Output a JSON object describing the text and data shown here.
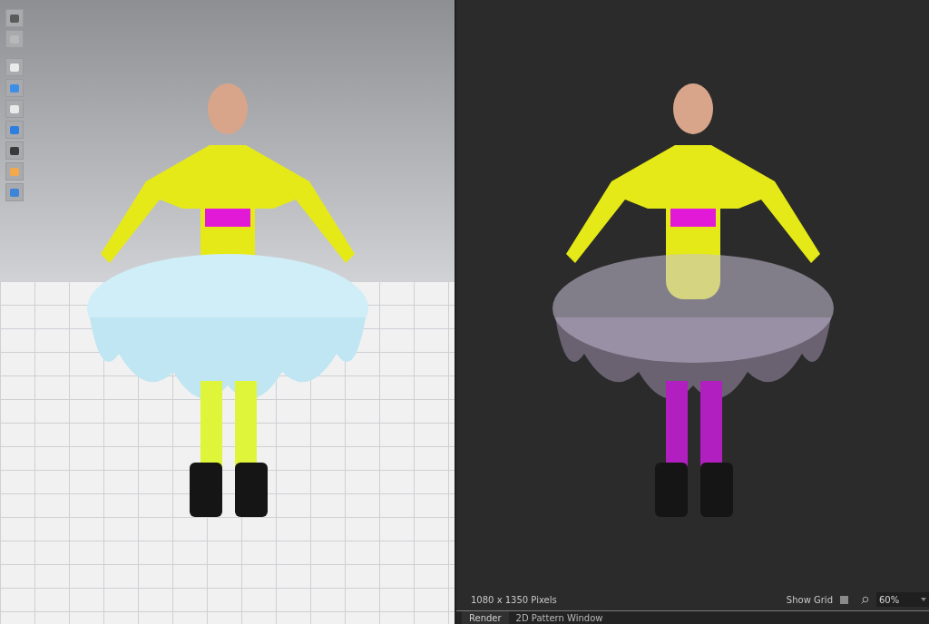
{
  "render_panel": {
    "resolution": "1080 x 1350 Pixels",
    "show_grid": {
      "label": "Show Grid",
      "checked": false
    },
    "zoom": {
      "value": "60%"
    }
  },
  "tabs": [
    {
      "label": "Render",
      "selected": true
    },
    {
      "label": "2D Pattern Window",
      "selected": false
    }
  ]
}
